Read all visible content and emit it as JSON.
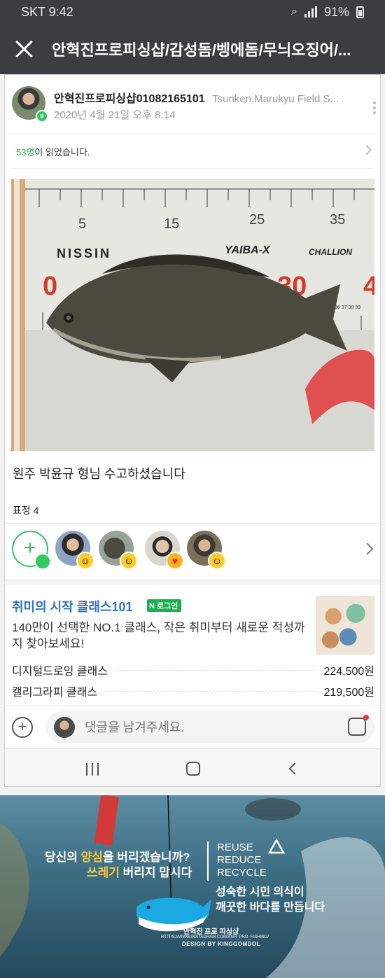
{
  "status_bar": {
    "carrier_time": "SKT 9:42",
    "battery": "91%"
  },
  "header": {
    "title": "안혁진프로피싱샵/감성돔/벵에돔/무늬오징어/..."
  },
  "post": {
    "author": "안혁진프로피싱샵01082165101",
    "group": "Tsuriken,Marukyu Field S...",
    "date": "2020년 4월 21일 오후 8:14",
    "read_count": "53명",
    "read_suffix": "이 읽었습니다.",
    "photo_scale_numbers": [
      "5",
      "15",
      "25",
      "35"
    ],
    "photo_big_numbers": [
      "0",
      "30",
      "4"
    ],
    "photo_small_numbers": "36 37 38 39",
    "photo_brands": [
      "NISSIN",
      "YAIBA-X",
      "CHALLION"
    ],
    "caption": "원주  박윤규 형님 수고하셨습니다"
  },
  "reactions": {
    "label": "표정 4"
  },
  "ad": {
    "title": "취미의 시작 클래스101",
    "login_badge": "로그인",
    "description": "140만이 선택한 NO.1 클래스, 작은 취미부터 새로운 적성까지 찾아보세요!",
    "items": [
      {
        "name": "디지털드로잉 클래스",
        "price": "224,500원"
      },
      {
        "name": "캘리그라피 클래스",
        "price": "219,500원"
      }
    ]
  },
  "comment": {
    "placeholder": "댓글을 남겨주세요."
  },
  "banner": {
    "line1_a": "당신의 ",
    "line1_hl": "양심",
    "line1_b": "을 버리겠습니까?",
    "line2_hl": "쓰레기",
    "line2_b": " 버리지 맙시다",
    "rrr": [
      "REUSE",
      "REDUCE",
      "RECYCLE"
    ],
    "civic1": "성숙한 시민 의식이",
    "civic2": "깨끗한 바다를 만듭니다",
    "shop": "안혁진 프로 피싱샵",
    "insta": "HTTPS://WWW.INSTAGRAM.COM/ANH_PRO_FISHING/",
    "design": "DESIGN BY KINGGOMDOL"
  },
  "colors": {
    "header": "#3c3d41",
    "accent_green": "#2bb34c",
    "ad_title": "#2f73c5"
  }
}
